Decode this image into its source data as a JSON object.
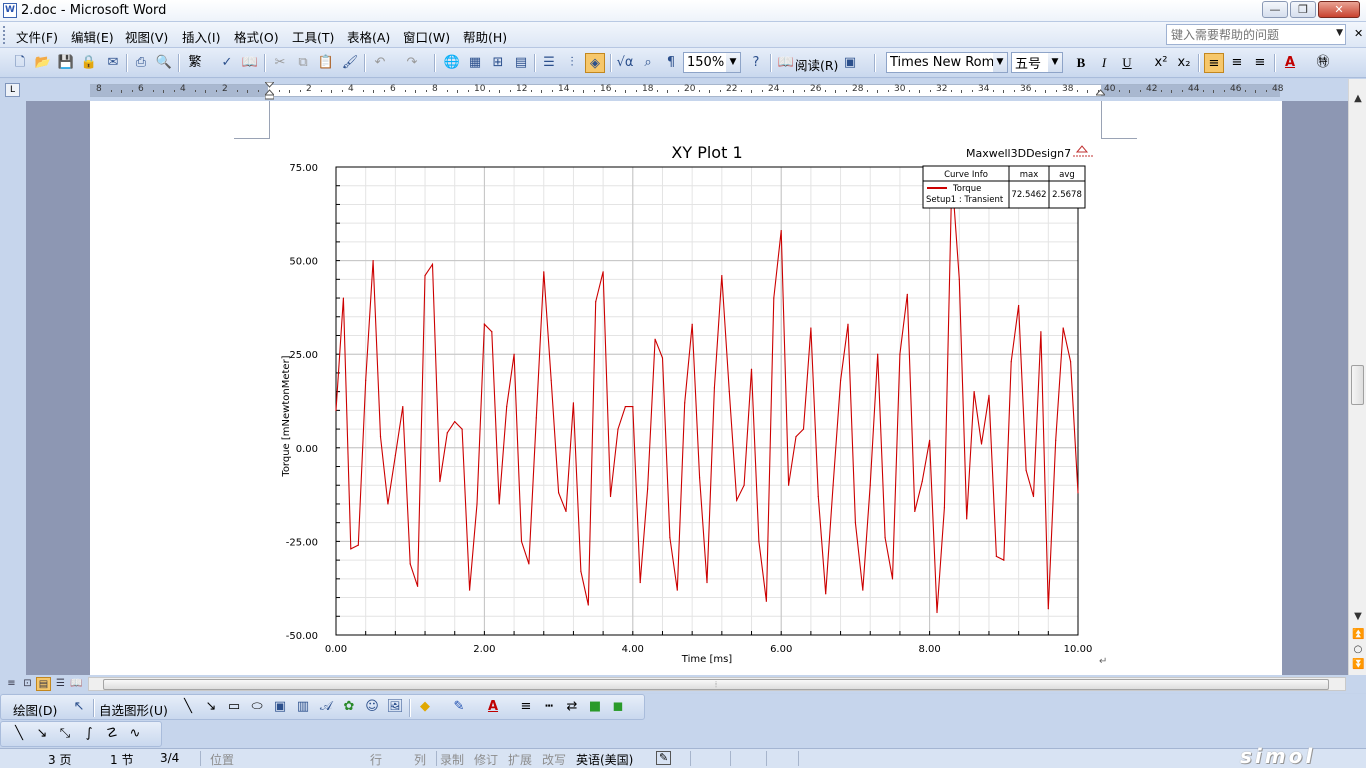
{
  "window": {
    "title": "2.doc - Microsoft Word",
    "buttons": {
      "minimize": "—",
      "maximize": "❐",
      "close": "✕"
    }
  },
  "menubar": {
    "items": [
      "文件(F)",
      "编辑(E)",
      "视图(V)",
      "插入(I)",
      "格式(O)",
      "工具(T)",
      "表格(A)",
      "窗口(W)",
      "帮助(H)"
    ],
    "help_placeholder": "键入需要帮助的问题"
  },
  "toolbar": {
    "zoom": "150%",
    "read_label": "阅读(R)",
    "traditional_label": "繁",
    "font_name": "Times New Roman",
    "font_size": "五号",
    "bold": "B",
    "italic": "I",
    "underline": "U"
  },
  "ruler": {
    "labels": [
      "8",
      "6",
      "4",
      "2",
      "2",
      "4",
      "6",
      "8",
      "10",
      "12",
      "14",
      "16",
      "18",
      "20",
      "22",
      "24",
      "26",
      "28",
      "30",
      "32",
      "34",
      "36",
      "38",
      "40",
      "42",
      "44",
      "46",
      "48"
    ]
  },
  "draw_toolbar": {
    "draw_label": "绘图(D)",
    "autoshape_label": "自选图形(U)"
  },
  "statusbar": {
    "page": "3 页",
    "section": "1 节",
    "page_of": "3/4",
    "position": "位置",
    "line": "行",
    "column": "列",
    "rec": "录制",
    "trk": "修订",
    "ext": "扩展",
    "ovr": "改写",
    "language": "英语(美国)"
  },
  "watermark": "simol",
  "chart_data": {
    "type": "line",
    "title": "XY Plot 1",
    "design_name": "Maxwell3DDesign7",
    "xlabel": "Time [ms]",
    "ylabel": "Torque [mNewtonMeter]",
    "xlim": [
      0,
      10
    ],
    "ylim": [
      -50,
      75
    ],
    "x_ticks": [
      "0.00",
      "2.00",
      "4.00",
      "6.00",
      "8.00",
      "10.00"
    ],
    "y_ticks": [
      "75.00",
      "50.00",
      "25.00",
      "0.00",
      "-25.00",
      "-50.00"
    ],
    "grid": true,
    "legend": {
      "position": "top-right",
      "headers": [
        "Curve Info",
        "max",
        "avg"
      ],
      "rows": [
        {
          "name": "Torque",
          "setup": "Setup1 : Transient",
          "max": "72.5462",
          "avg": "2.5678",
          "color": "#cc0000"
        }
      ]
    },
    "series": [
      {
        "name": "Torque",
        "color": "#cc0000",
        "x": [
          0.0,
          0.1,
          0.2,
          0.3,
          0.4,
          0.5,
          0.6,
          0.7,
          0.8,
          0.9,
          1.0,
          1.1,
          1.2,
          1.3,
          1.4,
          1.5,
          1.6,
          1.7,
          1.8,
          1.9,
          2.0,
          2.1,
          2.2,
          2.3,
          2.4,
          2.5,
          2.6,
          2.7,
          2.8,
          2.9,
          3.0,
          3.1,
          3.2,
          3.3,
          3.4,
          3.5,
          3.6,
          3.7,
          3.8,
          3.9,
          4.0,
          4.1,
          4.2,
          4.3,
          4.4,
          4.5,
          4.6,
          4.7,
          4.8,
          4.9,
          5.0,
          5.1,
          5.2,
          5.3,
          5.4,
          5.5,
          5.6,
          5.7,
          5.8,
          5.9,
          6.0,
          6.1,
          6.2,
          6.3,
          6.4,
          6.5,
          6.6,
          6.7,
          6.8,
          6.9,
          7.0,
          7.1,
          7.2,
          7.3,
          7.4,
          7.5,
          7.6,
          7.7,
          7.8,
          7.9,
          8.0,
          8.1,
          8.2,
          8.3,
          8.4,
          8.5,
          8.6,
          8.7,
          8.8,
          8.9,
          9.0,
          9.1,
          9.2,
          9.3,
          9.4,
          9.5,
          9.6,
          9.7,
          9.8,
          9.9,
          10.0
        ],
        "values": [
          10,
          40,
          -27,
          -26,
          18,
          50,
          3,
          -15,
          -2,
          11,
          -31,
          -37,
          46,
          49,
          -9,
          4,
          7,
          5,
          -38,
          -15,
          33,
          31,
          -15,
          11,
          25,
          -25,
          -31,
          8,
          47,
          18,
          -12,
          -17,
          12,
          -33,
          -42,
          39,
          47,
          -13,
          5,
          11,
          11,
          -36,
          -11,
          29,
          24,
          -24,
          -38,
          12,
          33,
          -8,
          -36,
          16,
          46,
          15,
          -14,
          -10,
          21,
          -25,
          -41,
          40,
          58,
          -10,
          3,
          5,
          32,
          -13,
          -39,
          -10,
          18,
          33,
          -20,
          -38,
          -10,
          25,
          -24,
          -35,
          25,
          41,
          -17,
          -9,
          2,
          -44,
          -16,
          73,
          45,
          -19,
          15,
          1,
          14,
          -29,
          -30,
          23,
          38,
          -6,
          -13,
          31,
          -43,
          2,
          32,
          23,
          -12
        ]
      }
    ]
  }
}
